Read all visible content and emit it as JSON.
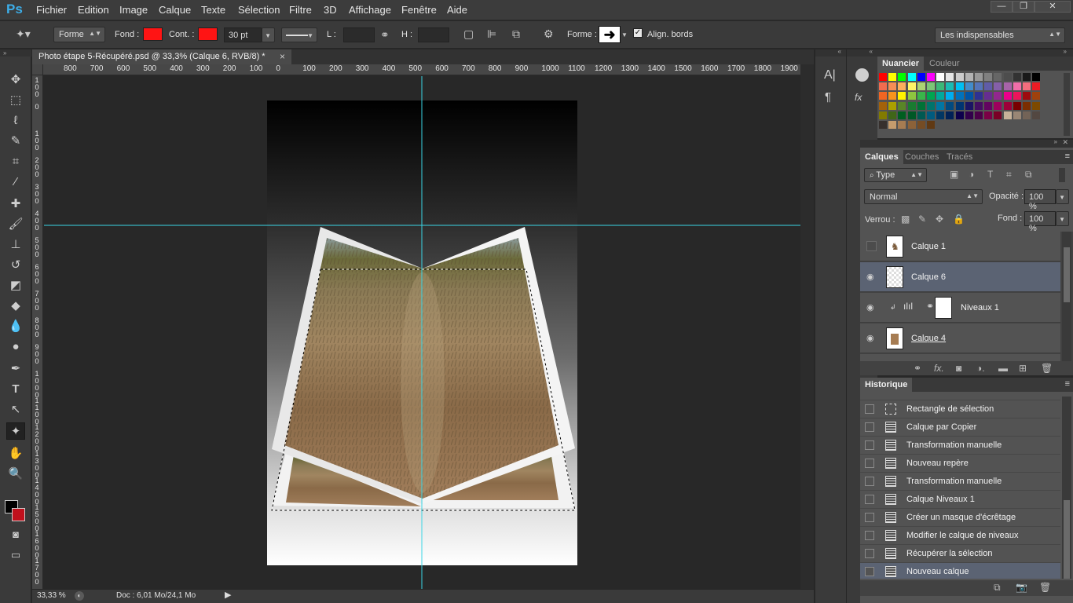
{
  "app": {
    "logo": "Ps"
  },
  "menu": [
    "Fichier",
    "Edition",
    "Image",
    "Calque",
    "Texte",
    "Sélection",
    "Filtre",
    "3D",
    "Affichage",
    "Fenêtre",
    "Aide"
  ],
  "window_controls": [
    "—",
    "❐",
    "✕"
  ],
  "options": {
    "mode": "Forme",
    "fill_label": "Fond :",
    "stroke_label": "Cont. :",
    "stroke_width": "30 pt",
    "w_label": "L :",
    "h_label": "H :",
    "shape_label": "Forme :",
    "align_label": "Align. bords",
    "workspace": "Les indispensables",
    "fill_color": "#ff1414",
    "stroke_color": "#ff1414"
  },
  "document": {
    "tab_title": "Photo étape 5-Récupéré.psd @ 33,3% (Calque 6, RVB/8) *",
    "close": "×"
  },
  "ruler": {
    "h_labels": [
      "800",
      "700",
      "600",
      "500",
      "400",
      "300",
      "200",
      "100",
      "0",
      "100",
      "200",
      "300",
      "400",
      "500",
      "600",
      "700",
      "800",
      "900",
      "1000",
      "1100",
      "1200",
      "1300",
      "1400",
      "1500",
      "1600",
      "1700",
      "1800",
      "1900",
      "20"
    ],
    "v_labels": [
      "100",
      "0",
      "100",
      "200",
      "300",
      "400",
      "500",
      "600",
      "700",
      "800",
      "900",
      "1000",
      "1100",
      "1200",
      "1300",
      "1400",
      "1500",
      "1600",
      "1700"
    ]
  },
  "status": {
    "zoom": "33,33 %",
    "doc": "Doc : 6,01 Mo/24,1 Mo"
  },
  "swatches_panel": {
    "tabs": [
      "Nuancier",
      "Couleur"
    ],
    "colors": [
      "#ff0000",
      "#ffff00",
      "#00ff00",
      "#00ffff",
      "#0000ff",
      "#ff00ff",
      "#ffffff",
      "#e6e6e6",
      "#cccccc",
      "#b3b3b3",
      "#999999",
      "#808080",
      "#666666",
      "#4d4d4d",
      "#333333",
      "#1a1a1a",
      "#000000",
      "#f26c4f",
      "#f68e55",
      "#fbaf5c",
      "#fff467",
      "#acd372",
      "#7cc576",
      "#3bb878",
      "#1abbb4",
      "#00bff3",
      "#438ccb",
      "#5574b9",
      "#605ca8",
      "#855fa8",
      "#a763a8",
      "#f06ea9",
      "#f26d7d",
      "#ed1c24",
      "#f26522",
      "#f7941d",
      "#fff200",
      "#8dc63f",
      "#39b54a",
      "#00a651",
      "#00a99d",
      "#00aeef",
      "#0072bc",
      "#0054a6",
      "#2e3192",
      "#662d91",
      "#92278f",
      "#ec008c",
      "#ed145b",
      "#9e0b0f",
      "#a0410d",
      "#a3620a",
      "#aba000",
      "#598527",
      "#197b30",
      "#007236",
      "#00746b",
      "#0076a3",
      "#004a80",
      "#003471",
      "#1b1464",
      "#440e62",
      "#630460",
      "#9e005d",
      "#9e0039",
      "#790000",
      "#7b2e00",
      "#7d4900",
      "#827b00",
      "#406618",
      "#005e20",
      "#005826",
      "#005952",
      "#005b7f",
      "#003663",
      "#002157",
      "#0d004c",
      "#32004b",
      "#4b0049",
      "#7b0046",
      "#7a0026",
      "#c7b299",
      "#998675",
      "#736357",
      "#534741",
      "#37302d",
      "#c69c6d",
      "#a67c52",
      "#8c6239",
      "#754c24",
      "#603913"
    ]
  },
  "layers_panel": {
    "tabs": [
      "Calques",
      "Couches",
      "Tracés"
    ],
    "filter": "Type",
    "blend": "Normal",
    "opacity_label": "Opacité :",
    "opacity": "100 %",
    "lock_label": "Verrou :",
    "fill_label": "Fond :",
    "fill": "100 %",
    "layers": [
      {
        "name": "Calque 1",
        "visible": false,
        "selected": false
      },
      {
        "name": "Calque 6",
        "visible": true,
        "selected": true
      },
      {
        "name": "Niveaux 1",
        "visible": true,
        "selected": false
      },
      {
        "name": "Calque 4",
        "visible": true,
        "selected": false
      }
    ]
  },
  "history_panel": {
    "title": "Historique",
    "items": [
      {
        "name": "Rectangle de sélection",
        "selected": false
      },
      {
        "name": "Calque par Copier",
        "selected": false
      },
      {
        "name": "Transformation manuelle",
        "selected": false
      },
      {
        "name": "Nouveau repère",
        "selected": false
      },
      {
        "name": "Transformation manuelle",
        "selected": false
      },
      {
        "name": "Calque Niveaux 1",
        "selected": false
      },
      {
        "name": "Créer un masque d'écrêtage",
        "selected": false
      },
      {
        "name": "Modifier le calque de niveaux",
        "selected": false
      },
      {
        "name": "Récupérer la sélection",
        "selected": false
      },
      {
        "name": "Nouveau calque",
        "selected": true
      }
    ]
  },
  "icons": [
    "move-icon",
    "marquee-icon",
    "lasso-icon",
    "quick-select-icon",
    "crop-icon",
    "eyedropper-icon",
    "healing-icon",
    "brush-icon",
    "stamp-icon",
    "history-brush-icon",
    "eraser-icon",
    "bucket-icon",
    "blur-icon",
    "dodge-icon",
    "pen-icon",
    "type-icon",
    "path-select-icon",
    "custom-shape-icon",
    "hand-icon",
    "zoom-icon"
  ]
}
